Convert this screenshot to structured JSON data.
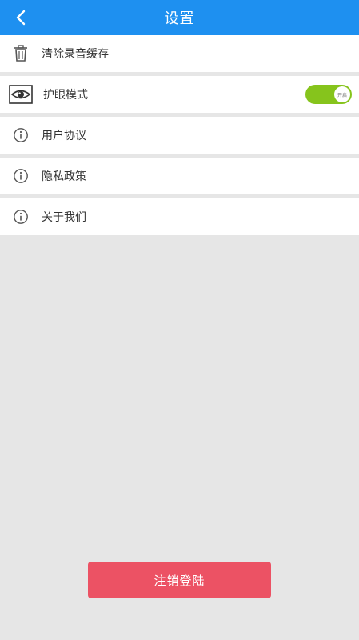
{
  "header": {
    "title": "设置"
  },
  "settings": {
    "clear_cache": "清除录音缓存",
    "eye_mode": "护眼模式",
    "eye_mode_toggle_text": "开启",
    "user_agreement": "用户协议",
    "privacy_policy": "隐私政策",
    "about_us": "关于我们"
  },
  "actions": {
    "logout_label": "注销登陆"
  },
  "colors": {
    "header_bg": "#1e90f0",
    "toggle_on": "#86c41c",
    "logout_bg": "#ec5264",
    "page_bg": "#e6e6e6"
  },
  "icons": {
    "back": "chevron-left-icon",
    "clear_cache": "trash-icon",
    "eye_mode": "eye-icon",
    "info": "info-icon"
  }
}
